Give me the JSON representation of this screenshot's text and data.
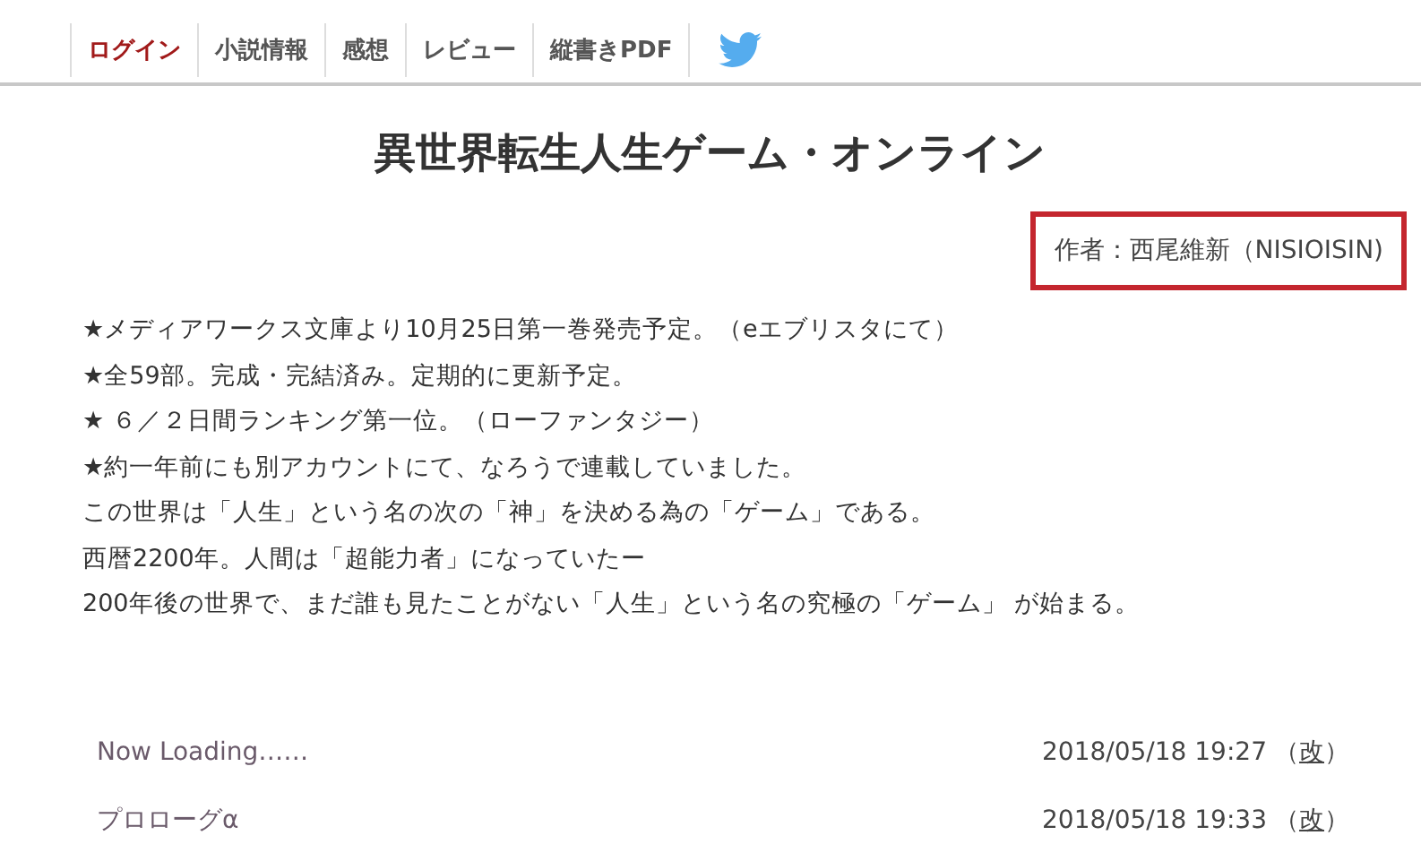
{
  "nav": {
    "items": [
      {
        "label": "ログイン",
        "selected": true
      },
      {
        "label": "小説情報",
        "selected": false
      },
      {
        "label": "感想",
        "selected": false
      },
      {
        "label": "レビュー",
        "selected": false
      },
      {
        "label": "縦書きPDF",
        "selected": false
      }
    ]
  },
  "title": "異世界転生人生ゲーム・オンライン",
  "author": "作者：西尾維新（NISIOISIN)",
  "synopsis": [
    "★メディアワークス文庫より10月25日第一巻発売予定。（eエブリスタにて）",
    "★全59部。完成・完結済み。定期的に更新予定。",
    "★ ６／２日間ランキング第一位。（ローファンタジー）",
    "★約一年前にも別アカウントにて、なろうで連載していました。",
    "この世界は「人生」という名の次の「神」を決める為の「ゲーム」である。",
    "西暦2200年。人間は「超能力者」になっていたー",
    "200年後の世界で、まだ誰も見たことがない「人生」という名の究極の「ゲーム」 が始まる。"
  ],
  "episodes": [
    {
      "title": "Now Loading……",
      "date": "2018/05/18 19:27",
      "revision": {
        "open": "（",
        "label": "改",
        "close": "）"
      }
    },
    {
      "title": "プロローグα",
      "date": "2018/05/18 19:33",
      "revision": {
        "open": "（",
        "label": "改",
        "close": "）"
      }
    }
  ]
}
